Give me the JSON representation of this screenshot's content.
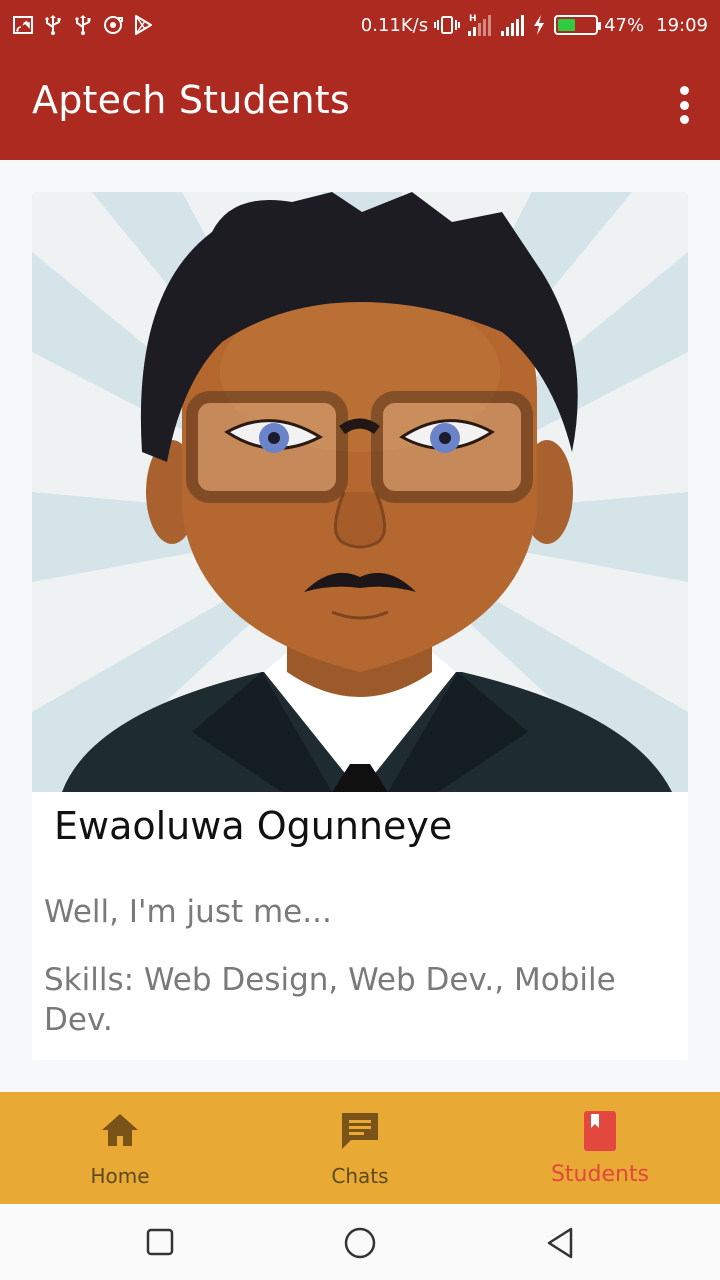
{
  "status_bar": {
    "speed": "0.11K/s",
    "battery": "47%",
    "time": "19:09",
    "battery_level": 0.47,
    "icons": [
      "screencast-icon",
      "usb-icon",
      "usb-icon",
      "sync-icon",
      "play-store-icon",
      "vibrate-icon",
      "signal-h-icon",
      "signal-icon",
      "charging-icon",
      "battery-icon"
    ]
  },
  "app_bar": {
    "title": "Aptech Students",
    "menu_icon": "more-vert-icon"
  },
  "profile": {
    "name": "Ewaoluwa Ogunneye",
    "bio": "Well, I'm just me...",
    "skills": "Skills: Web Design, Web Dev., Mobile Dev."
  },
  "bottom_nav": {
    "items": [
      {
        "label": "Home",
        "icon": "home-icon",
        "active": false
      },
      {
        "label": "Chats",
        "icon": "chat-icon",
        "active": false
      },
      {
        "label": "Students",
        "icon": "bookmark-book-icon",
        "active": true
      }
    ]
  },
  "system_nav": {
    "buttons": [
      "recents-square-icon",
      "home-circle-icon",
      "back-triangle-icon"
    ]
  },
  "colors": {
    "primary": "#ad2a20",
    "bottom_nav_bg": "#e8a935",
    "active_tab": "#e2483d",
    "inactive_tab": "#5e4a1f"
  }
}
